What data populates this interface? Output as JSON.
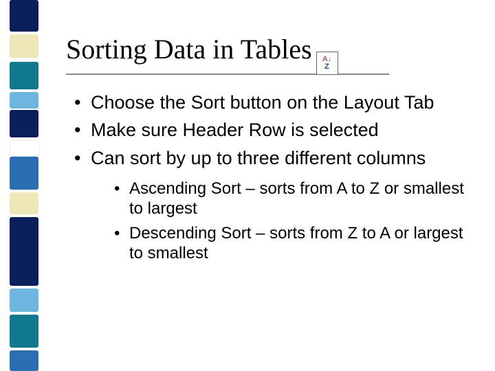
{
  "title": "Sorting Data in Tables",
  "title_icon": {
    "name": "sort-icon",
    "glyph_a": "A↓",
    "glyph_z": "Z",
    "label": "Sort"
  },
  "bullets_level1": [
    "Choose the Sort button on the Layout Tab",
    "Make sure Header Row is selected",
    "Can sort by up to three different columns"
  ],
  "bullets_level2": [
    "Ascending Sort – sorts from A to Z or smallest to largest",
    "Descending Sort – sorts from Z to A or largest to smallest"
  ],
  "deco_colors": {
    "navy": "#0a1f5c",
    "cream": "#efe7b8",
    "teal": "#0f7a8f",
    "lightblue": "#6cb6e0",
    "blue": "#2b6fb3",
    "white": "#ffffff"
  }
}
